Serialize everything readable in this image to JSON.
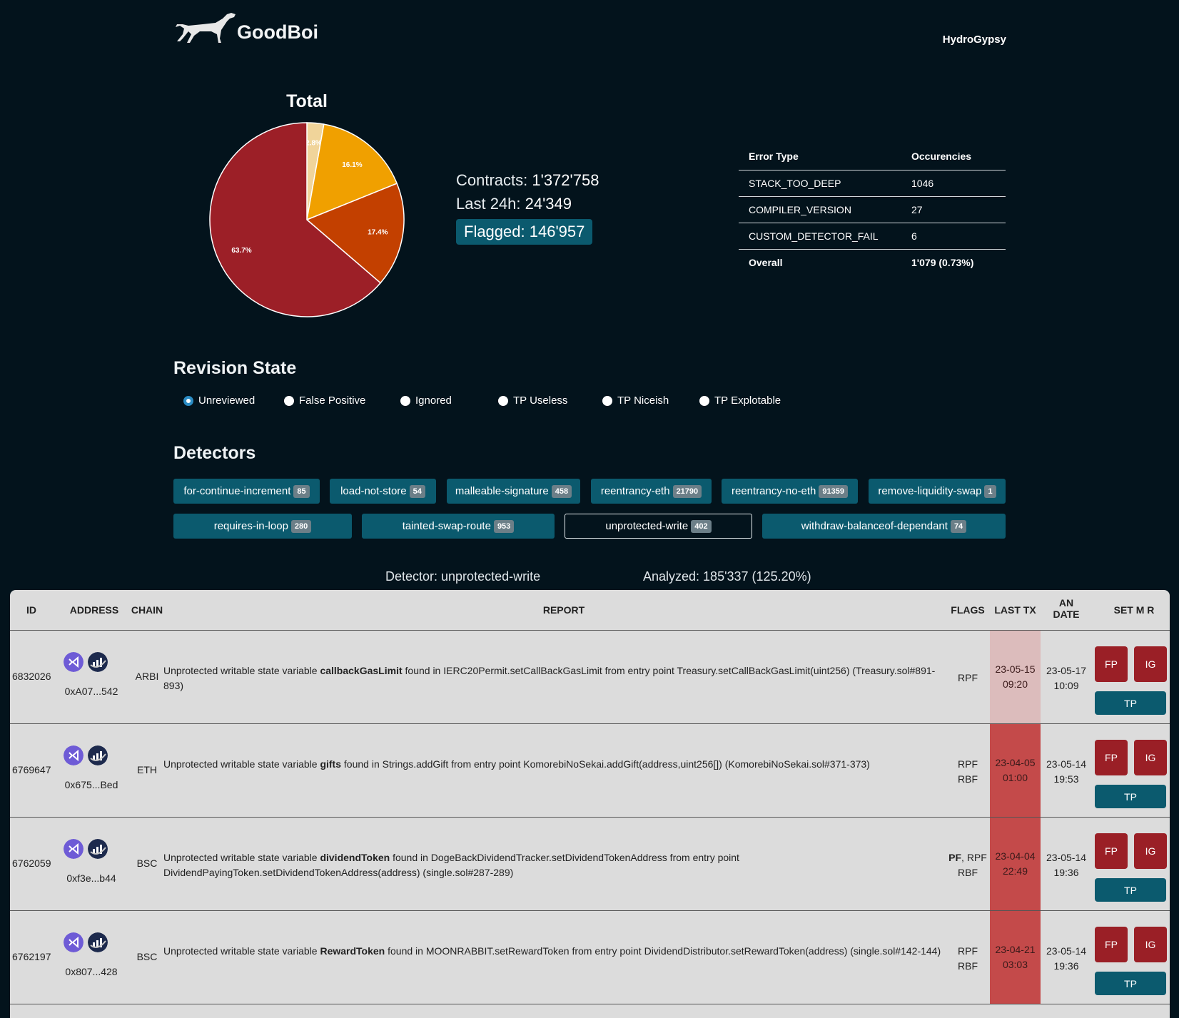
{
  "header": {
    "brand": "GoodBoi",
    "user": "HydroGypsy"
  },
  "pie": {
    "title": "Total",
    "slices": [
      {
        "label": "2.8%",
        "value": 2.8,
        "color": "#f0d49a"
      },
      {
        "label": "16.1%",
        "value": 16.1,
        "color": "#f0a000"
      },
      {
        "label": "17.4%",
        "value": 17.4,
        "color": "#c34000"
      },
      {
        "label": "63.7%",
        "value": 63.7,
        "color": "#9c1f27"
      }
    ]
  },
  "stats": {
    "contracts_label": "Contracts:",
    "contracts": "1'372'758",
    "last24_label": "Last 24h:",
    "last24": "24'349",
    "flagged_label": "Flagged:",
    "flagged": "146'957"
  },
  "errors": {
    "headers": [
      "Error Type",
      "Occurencies"
    ],
    "rows": [
      [
        "STACK_TOO_DEEP",
        "1046"
      ],
      [
        "COMPILER_VERSION",
        "27"
      ],
      [
        "CUSTOM_DETECTOR_FAIL",
        "6"
      ]
    ],
    "overall": [
      "Overall",
      "1'079 (0.73%)"
    ]
  },
  "revision": {
    "title": "Revision State",
    "options": [
      "Unreviewed",
      "False Positive",
      "Ignored",
      "TP Useless",
      "TP Niceish",
      "TP Explotable"
    ]
  },
  "detectors": {
    "title": "Detectors",
    "items": [
      {
        "name": "for-continue-increment",
        "count": "85"
      },
      {
        "name": "load-not-store",
        "count": "54"
      },
      {
        "name": "malleable-signature",
        "count": "458"
      },
      {
        "name": "reentrancy-eth",
        "count": "21790"
      },
      {
        "name": "reentrancy-no-eth",
        "count": "91359"
      },
      {
        "name": "remove-liquidity-swap",
        "count": "1"
      },
      {
        "name": "requires-in-loop",
        "count": "280"
      },
      {
        "name": "tainted-swap-route",
        "count": "953"
      },
      {
        "name": "unprotected-write",
        "count": "402"
      },
      {
        "name": "withdraw-balanceof-dependant",
        "count": "74"
      }
    ]
  },
  "info": {
    "detector": "Detector: unprotected-write",
    "analyzed": "Analyzed: 185'337 (125.20%)"
  },
  "table": {
    "headers": {
      "id": "ID",
      "address": "ADDRESS",
      "chain": "CHAIN",
      "report": "REPORT",
      "flags": "FLAGS",
      "lasttx": "LAST TX",
      "an_date_1": "AN",
      "an_date_2": "DATE",
      "set": "SET M R"
    },
    "buttons": {
      "fp": "FP",
      "ig": "IG",
      "tp": "TP"
    },
    "rows": [
      {
        "id": "6832026",
        "address": "0xA07...542",
        "chain": "ARBI",
        "report_pre": "Unprotected writable state variable ",
        "report_var": "callbackGasLimit",
        "report_post": " found in IERC20Permit.setCallBackGasLimit from entry point Treasury.setCallBackGasLimit(uint256) (Treasury.sol#891-893)",
        "flags_bold": "",
        "flags_1": "RPF",
        "flags_2": "",
        "lasttx_1": "23-05-15",
        "lasttx_2": "09:20",
        "lasttx_color": "#dcbcbc",
        "andate_1": "23-05-17",
        "andate_2": "10:09"
      },
      {
        "id": "6769647",
        "address": "0x675...Bed",
        "chain": "ETH",
        "report_pre": "Unprotected writable state variable ",
        "report_var": "gifts",
        "report_post": " found in Strings.addGift from entry point KomorebiNoSekai.addGift(address,uint256[]) (KomorebiNoSekai.sol#371-373)",
        "flags_bold": "",
        "flags_1": "RPF",
        "flags_2": "RBF",
        "lasttx_1": "23-04-05",
        "lasttx_2": "01:00",
        "lasttx_color": "#c44a4a",
        "andate_1": "23-05-14",
        "andate_2": "19:53"
      },
      {
        "id": "6762059",
        "address": "0xf3e...b44",
        "chain": "BSC",
        "report_pre": "Unprotected writable state variable ",
        "report_var": "dividendToken",
        "report_post": " found in DogeBackDividendTracker.setDividendTokenAddress from entry point DividendPayingToken.setDividendTokenAddress(address) (single.sol#287-289)",
        "flags_bold": "PF",
        "flags_1": ", RPF",
        "flags_2": "RBF",
        "lasttx_1": "23-04-04",
        "lasttx_2": "22:49",
        "lasttx_color": "#c44a4a",
        "andate_1": "23-05-14",
        "andate_2": "19:36"
      },
      {
        "id": "6762197",
        "address": "0x807...428",
        "chain": "BSC",
        "report_pre": "Unprotected writable state variable ",
        "report_var": "RewardToken",
        "report_post": " found in MOONRABBIT.setRewardToken from entry point DividendDistributor.setRewardToken(address) (single.sol#142-144)",
        "flags_bold": "",
        "flags_1": "RPF",
        "flags_2": "RBF",
        "lasttx_1": "23-04-21",
        "lasttx_2": "03:03",
        "lasttx_color": "#c44a4a",
        "andate_1": "23-05-14",
        "andate_2": "19:36"
      }
    ]
  }
}
